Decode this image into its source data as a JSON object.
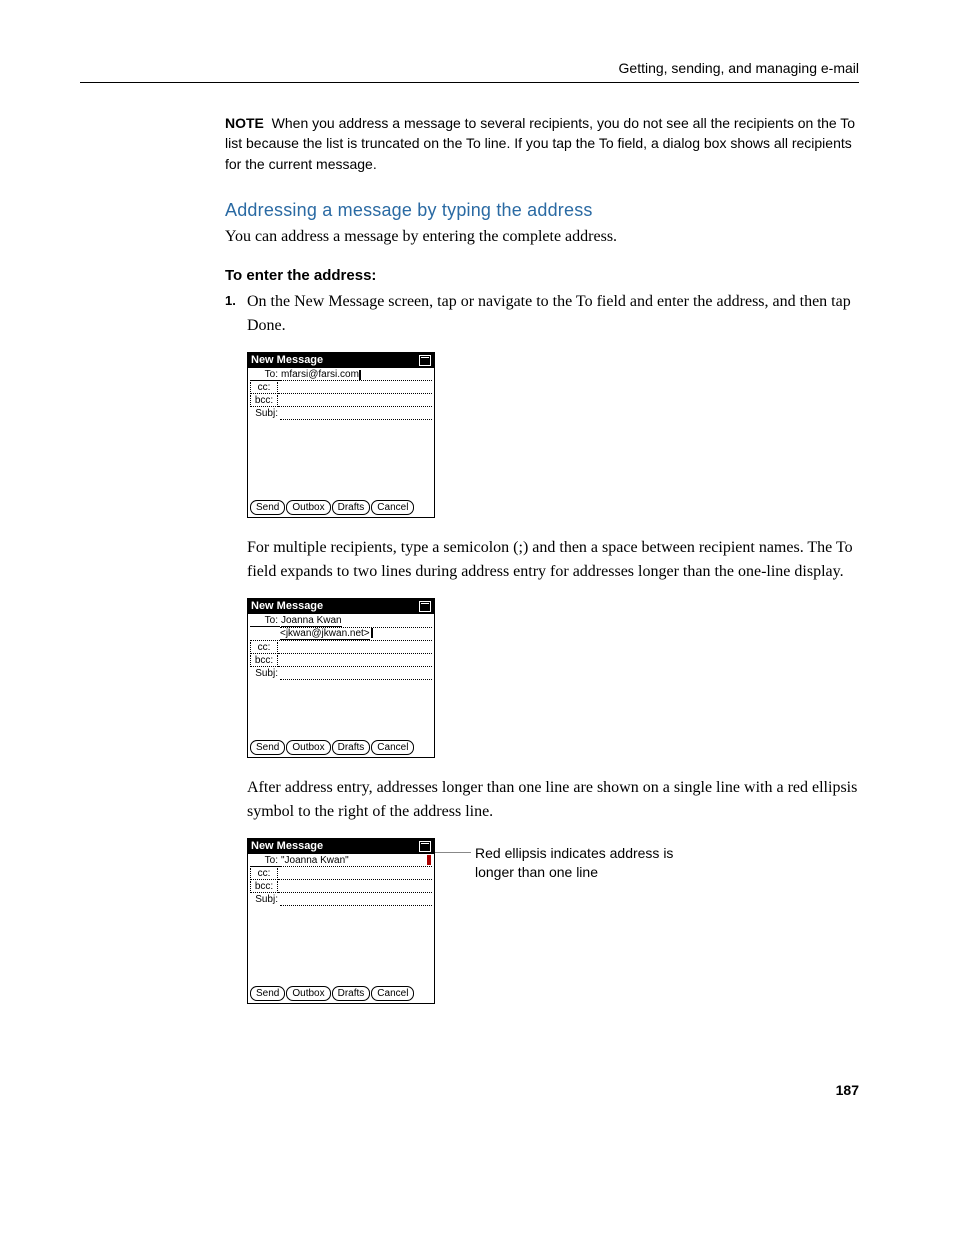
{
  "runningHead": "Getting, sending, and managing e-mail",
  "noteLabel": "NOTE",
  "noteText": "When you address a message to several recipients, you do not see all the recipients on the To list because the list is truncated on the To line. If you tap the To field, a dialog box shows all recipients for the current message.",
  "h2": "Addressing a message by typing the address",
  "intro": "You can address a message by entering the complete address.",
  "h3": "To enter the address:",
  "step1Num": "1.",
  "step1Text": "On the New Message screen, tap or navigate to the To field and enter the address, and then tap Done.",
  "paraMulti": "For multiple recipients, type a semicolon (;) and then a space between recipient names. The To field expands to two lines during address entry for addresses longer than the one-line display.",
  "paraEllipsis": "After address entry, addresses longer than one line are shown on a single line with a red ellipsis symbol to the right of the address line.",
  "pda": {
    "title": "New Message",
    "labels": {
      "to": "To:",
      "cc": "cc:",
      "bcc": "bcc:",
      "subj": "Subj:"
    },
    "shot1": {
      "to": "mfarsi@farsi.com"
    },
    "shot2": {
      "toLine1": "Joanna Kwan",
      "toLine2": "<jkwan@jkwan.net>"
    },
    "shot3": {
      "to": "\"Joanna Kwan\""
    },
    "buttons": {
      "send": "Send",
      "outbox": "Outbox",
      "drafts": "Drafts",
      "cancel": "Cancel"
    }
  },
  "callout": "Red ellipsis indicates address is longer than one line",
  "pageNum": "187"
}
